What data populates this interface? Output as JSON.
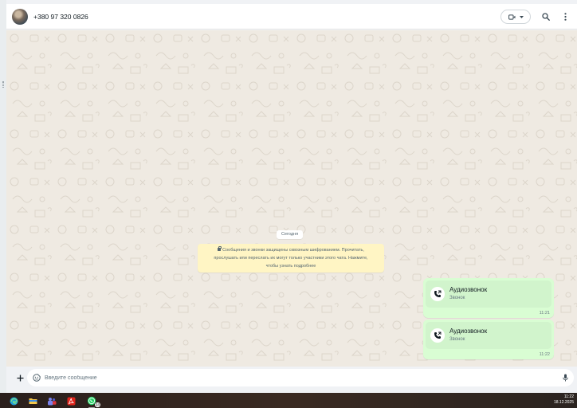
{
  "header": {
    "contact_name": "+380 97 320 0826",
    "avatar_icon": "contact-avatar",
    "video_icon": "video-camera-icon",
    "search_icon": "search-icon",
    "menu_icon": "more-vertical-icon"
  },
  "chat": {
    "date_chip": "Сегодня",
    "encryption_notice": {
      "line1": "Сообщения и звонки защищены сквозным шифрованием. Прочитать,",
      "line2": "прослушать или переслать их могут только участники этого чата. Нажмите,",
      "line3": "чтобы узнать подробнее"
    },
    "messages": [
      {
        "title": "Аудиозвонок",
        "subtitle": "Звонок",
        "time": "11:21",
        "icon": "outgoing-call-icon"
      },
      {
        "title": "Аудиозвонок",
        "subtitle": "Звонок",
        "time": "11:22",
        "icon": "outgoing-call-icon"
      }
    ]
  },
  "composer": {
    "placeholder": "Введите сообщение",
    "value": "",
    "plus_icon": "plus-icon",
    "emoji_icon": "sticker-emoji-icon",
    "mic_icon": "microphone-icon"
  },
  "taskbar": {
    "apps": [
      {
        "name": "edge-icon"
      },
      {
        "name": "file-explorer-icon"
      },
      {
        "name": "teams-icon"
      },
      {
        "name": "acrobat-icon"
      },
      {
        "name": "whatsapp-icon",
        "badge": "14"
      }
    ],
    "time": "11:22",
    "date": "18.12.2025"
  },
  "colors": {
    "chat_background": "#efeae2",
    "outgoing_bubble": "#d9fdd3",
    "notice_background": "#fff5c4",
    "header_background": "#ffffff"
  }
}
